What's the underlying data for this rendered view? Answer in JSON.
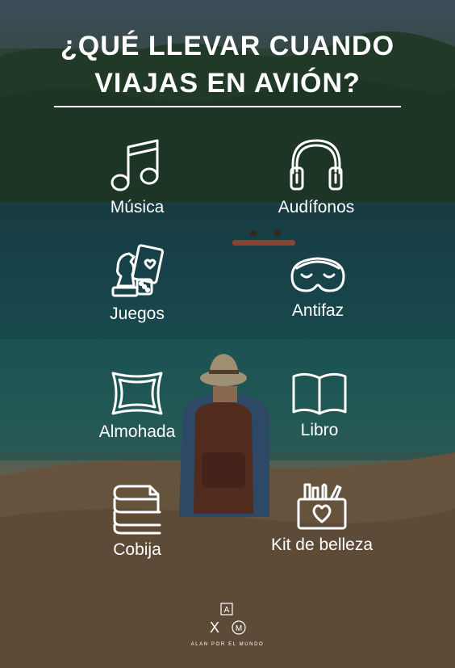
{
  "title": {
    "line1": "¿QUÉ LLEVAR CUANDO",
    "line2": "VIAJAS EN AVIÓN?"
  },
  "items": [
    {
      "label": "Música",
      "icon": "music-note-icon"
    },
    {
      "label": "Audífonos",
      "icon": "headphones-icon"
    },
    {
      "label": "Juegos",
      "icon": "games-icon"
    },
    {
      "label": "Antifaz",
      "icon": "sleep-mask-icon"
    },
    {
      "label": "Almohada",
      "icon": "pillow-icon"
    },
    {
      "label": "Libro",
      "icon": "book-icon"
    },
    {
      "label": "Cobija",
      "icon": "blanket-icon"
    },
    {
      "label": "Kit de belleza",
      "icon": "beauty-kit-icon"
    }
  ],
  "logo": {
    "letter_a": "A",
    "letter_x": "X",
    "letter_m": "M",
    "text": "ALAN POR EL MUNDO"
  },
  "colors": {
    "text": "#ffffff",
    "water": "#1d5a60",
    "forest": "#2b4b31"
  }
}
